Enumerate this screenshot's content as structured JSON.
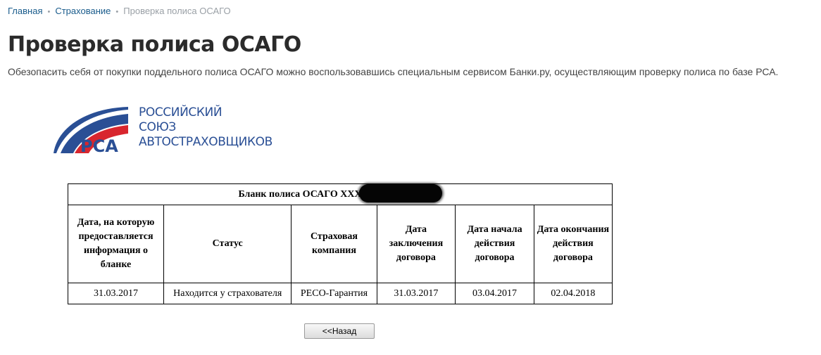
{
  "breadcrumb": {
    "home": "Главная",
    "section": "Страхование",
    "current": "Проверка полиса ОСАГО"
  },
  "page": {
    "title": "Проверка полиса ОСАГО",
    "subtitle": "Обезопасить себя от покупки поддельного полиса ОСАГО можно воспользовавшись специальным сервисом Банки.ру, осуществляющим проверку полиса по базе РСА."
  },
  "logo": {
    "abbr": "РСА",
    "line1": "РОССИЙСКИЙ",
    "line2": "СОЮЗ",
    "line3": "АВТОСТРАХОВЩИКОВ",
    "colors": {
      "blue": "#2a4f95",
      "red": "#d8262e"
    }
  },
  "policy_table": {
    "caption": "Бланк полиса ОСАГО XXX",
    "headers": [
      "Дата, на которую предоставляется информация о бланке",
      "Статус",
      "Страховая компания",
      "Дата заключения договора",
      "Дата начала действия договора",
      "Дата окончания действия договора"
    ],
    "row": [
      "31.03.2017",
      "Находится у страхователя",
      "РЕСО-Гарантия",
      "31.03.2017",
      "03.04.2017",
      "02.04.2018"
    ]
  },
  "back_button": {
    "label": "<<Назад"
  }
}
